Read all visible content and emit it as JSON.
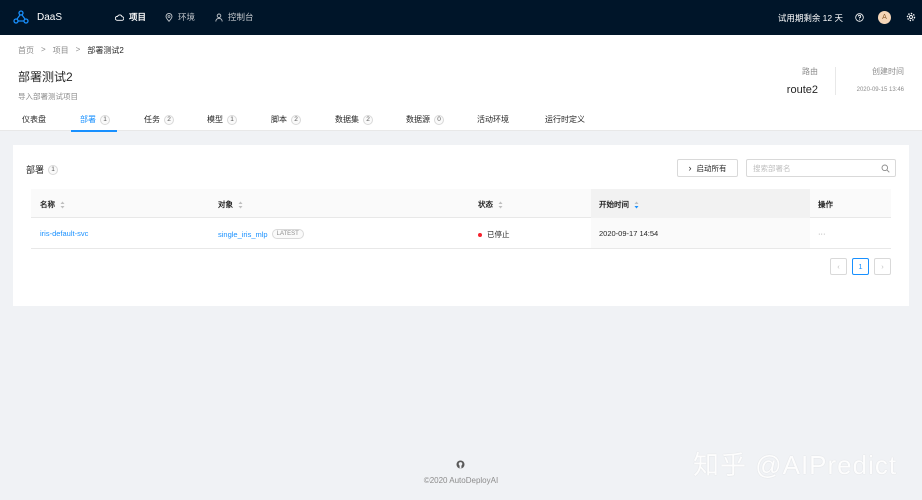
{
  "nav": {
    "brand": "DaaS",
    "items": [
      {
        "label": "项目",
        "icon": "cloud-icon",
        "active": true
      },
      {
        "label": "环境",
        "icon": "location-icon",
        "active": false
      },
      {
        "label": "控制台",
        "icon": "user-icon",
        "active": false
      }
    ],
    "trial": "试用期剩余 12 天",
    "avatar_letter": "A"
  },
  "breadcrumb": [
    "首页",
    "项目",
    "部署测试2"
  ],
  "page": {
    "title": "部署测试2",
    "description": "导入部署测试项目",
    "route_label": "路由",
    "route_value": "route2",
    "created_label": "创建时间",
    "created_value": "2020-09-15 13:46"
  },
  "tabs": [
    {
      "label": "仪表盘",
      "count": null
    },
    {
      "label": "部署",
      "count": "1",
      "active": true
    },
    {
      "label": "任务",
      "count": "2"
    },
    {
      "label": "模型",
      "count": "1"
    },
    {
      "label": "脚本",
      "count": "2"
    },
    {
      "label": "数据集",
      "count": "2"
    },
    {
      "label": "数据源",
      "count": "0"
    },
    {
      "label": "活动环境",
      "count": null
    },
    {
      "label": "运行时定义",
      "count": null
    }
  ],
  "card": {
    "title": "部署",
    "count": "1",
    "start_all": "启动所有",
    "search_placeholder": "搜索部署名"
  },
  "table": {
    "columns": [
      "名称",
      "对象",
      "状态",
      "开始时间",
      "操作"
    ],
    "rows": [
      {
        "name": "iris-default-svc",
        "object": "single_iris_mlp",
        "tag": "LATEST",
        "status": "已停止",
        "start_time": "2020-09-17 14:54",
        "action": "···"
      }
    ]
  },
  "pagination": {
    "prev": "‹",
    "current": "1",
    "next": "›"
  },
  "footer": {
    "copyright": "©2020 AutoDeployAI"
  },
  "watermark": "知乎 @AIPredict",
  "colors": {
    "primary": "#1890ff",
    "nav_bg": "#001529",
    "stopped": "#f5222d"
  }
}
